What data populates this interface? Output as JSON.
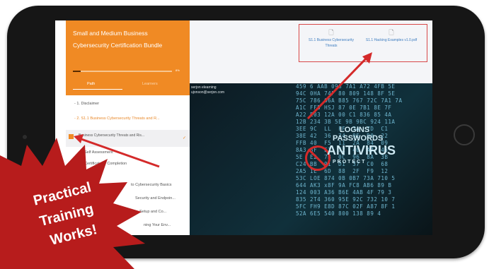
{
  "course": {
    "title": "Small and Medium Business Cybersecurity Certification Bundle",
    "progress_label": "8%",
    "progress_fraction": 0.08
  },
  "tabs": {
    "path": "Path",
    "learners": "Learners"
  },
  "nav": [
    "- 1. Disclaimer",
    "- 2. S1.1 Business Cybersecurity Threats and R...",
    "Business Cybersecurity Threats and Ris...",
    "Self Assessment",
    "Certificate of Completion",
    "to Cybersecurity Basics",
    "Security and Endpoin...",
    "Setup and Co...",
    "ning Your Env..."
  ],
  "downloads": [
    {
      "label": "S1.1 Business Cybersecurity Threats",
      "icon": "document-icon"
    },
    {
      "label": "S1.1 Hacking Examples v1.0.pdf",
      "icon": "document-icon"
    }
  ],
  "video": {
    "user": "serjon elearning",
    "email": "ujonson@serjon.com",
    "overlay_line1": "LOGINS",
    "overlay_line2": "PASSWORDS",
    "overlay_line3": "ANTIVIRUS",
    "overlay_line4": "PROTECT"
  },
  "badge": {
    "line1": "Practical",
    "line2": "Training",
    "line3": "Works!"
  },
  "colors": {
    "accent": "#f08a24",
    "highlight_red": "#d84848",
    "badge_red": "#b71c1c"
  }
}
